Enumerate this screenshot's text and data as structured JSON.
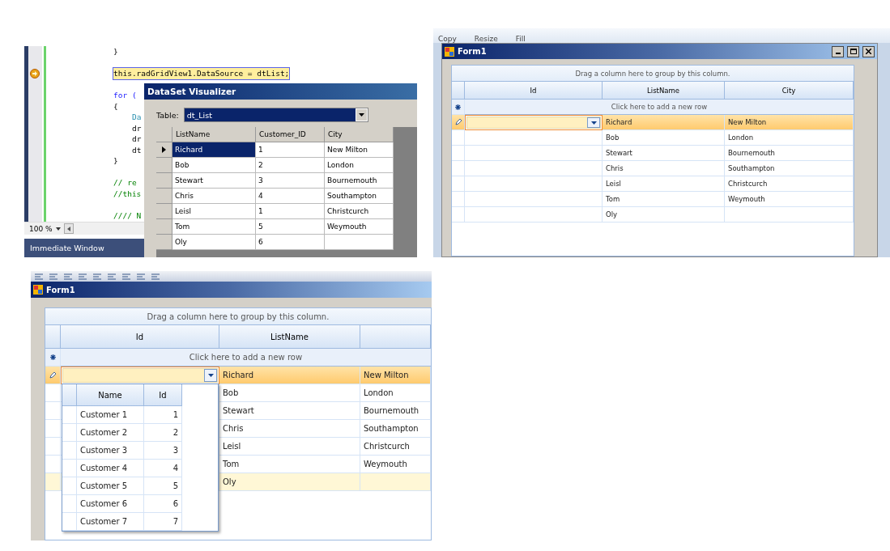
{
  "code_editor": {
    "lines": [
      {
        "kind": "brace",
        "text": "}"
      },
      {
        "kind": "blank"
      },
      {
        "kind": "current",
        "text": "this.radGridView1.DataSource = dtList;"
      },
      {
        "kind": "blank"
      },
      {
        "kind": "keyword",
        "text": "for ("
      },
      {
        "kind": "brace",
        "text": "{"
      },
      {
        "kind": "inner_type",
        "text": "Da"
      },
      {
        "kind": "inner",
        "text": "dr"
      },
      {
        "kind": "inner",
        "text": "dr"
      },
      {
        "kind": "inner",
        "text": "dt"
      },
      {
        "kind": "brace",
        "text": "}"
      },
      {
        "kind": "blank"
      },
      {
        "kind": "comment",
        "text": "// re"
      },
      {
        "kind": "comment",
        "text": "//this"
      },
      {
        "kind": "blank"
      },
      {
        "kind": "comment",
        "text": "//// N"
      }
    ],
    "zoom": "100 %",
    "bottom_panel": "Immediate Window"
  },
  "visualizer": {
    "title": "DataSet Visualizer",
    "table_label": "Table:",
    "table_value": "dt_List",
    "columns": [
      "ListName",
      "Customer_ID",
      "City"
    ],
    "rows": [
      {
        "cells": [
          "Richard",
          "1",
          "New Milton"
        ],
        "selected": true
      },
      {
        "cells": [
          "Bob",
          "2",
          "London"
        ],
        "selected": false
      },
      {
        "cells": [
          "Stewart",
          "3",
          "Bournemouth"
        ],
        "selected": false
      },
      {
        "cells": [
          "Chris",
          "4",
          "Southampton"
        ],
        "selected": false
      },
      {
        "cells": [
          "Leisl",
          "1",
          "Christcurch"
        ],
        "selected": false
      },
      {
        "cells": [
          "Tom",
          "5",
          "Weymouth"
        ],
        "selected": false
      },
      {
        "cells": [
          "Oly",
          "6",
          ""
        ],
        "selected": false
      }
    ]
  },
  "paint_ribbon": {
    "labels": [
      "Copy",
      "Resize",
      "Fill"
    ]
  },
  "form_grid": {
    "title": "Form1",
    "group_hint": "Drag a column here to group by this column.",
    "columns": [
      "Id",
      "ListName",
      "City"
    ],
    "new_row_hint": "Click here to add a new row",
    "rows": [
      {
        "cells": [
          "Richard",
          "New Milton"
        ],
        "current": true,
        "hover": false
      },
      {
        "cells": [
          "Bob",
          "London"
        ],
        "current": false,
        "hover": false
      },
      {
        "cells": [
          "Stewart",
          "Bournemouth"
        ],
        "current": false,
        "hover": false
      },
      {
        "cells": [
          "Chris",
          "Southampton"
        ],
        "current": false,
        "hover": false
      },
      {
        "cells": [
          "Leisl",
          "Christcurch"
        ],
        "current": false,
        "hover": false
      },
      {
        "cells": [
          "Tom",
          "Weymouth"
        ],
        "current": false,
        "hover": false
      },
      {
        "cells": [
          "Oly",
          ""
        ],
        "current": false,
        "hover": false
      }
    ]
  },
  "form_dropdown": {
    "title": "Form1",
    "group_hint": "Drag a column here to group by this column.",
    "columns": [
      "Id",
      "ListName"
    ],
    "new_row_hint": "Click here to add a new row",
    "rows": [
      {
        "cells": [
          "Richard",
          "New Milton"
        ],
        "current": true,
        "hover": false
      },
      {
        "cells": [
          "Bob",
          "London"
        ],
        "current": false,
        "hover": false
      },
      {
        "cells": [
          "Stewart",
          "Bournemouth"
        ],
        "current": false,
        "hover": false
      },
      {
        "cells": [
          "Chris",
          "Southampton"
        ],
        "current": false,
        "hover": false
      },
      {
        "cells": [
          "Leisl",
          "Christcurch"
        ],
        "current": false,
        "hover": false
      },
      {
        "cells": [
          "Tom",
          "Weymouth"
        ],
        "current": false,
        "hover": false
      },
      {
        "cells": [
          "Oly",
          ""
        ],
        "current": false,
        "hover": true
      }
    ],
    "dropdown": {
      "columns": [
        "Name",
        "Id"
      ],
      "rows": [
        [
          "Customer 1",
          "1"
        ],
        [
          "Customer 2",
          "2"
        ],
        [
          "Customer 3",
          "3"
        ],
        [
          "Customer 4",
          "4"
        ],
        [
          "Customer 5",
          "5"
        ],
        [
          "Customer 6",
          "6"
        ],
        [
          "Customer 7",
          "7"
        ]
      ]
    }
  }
}
